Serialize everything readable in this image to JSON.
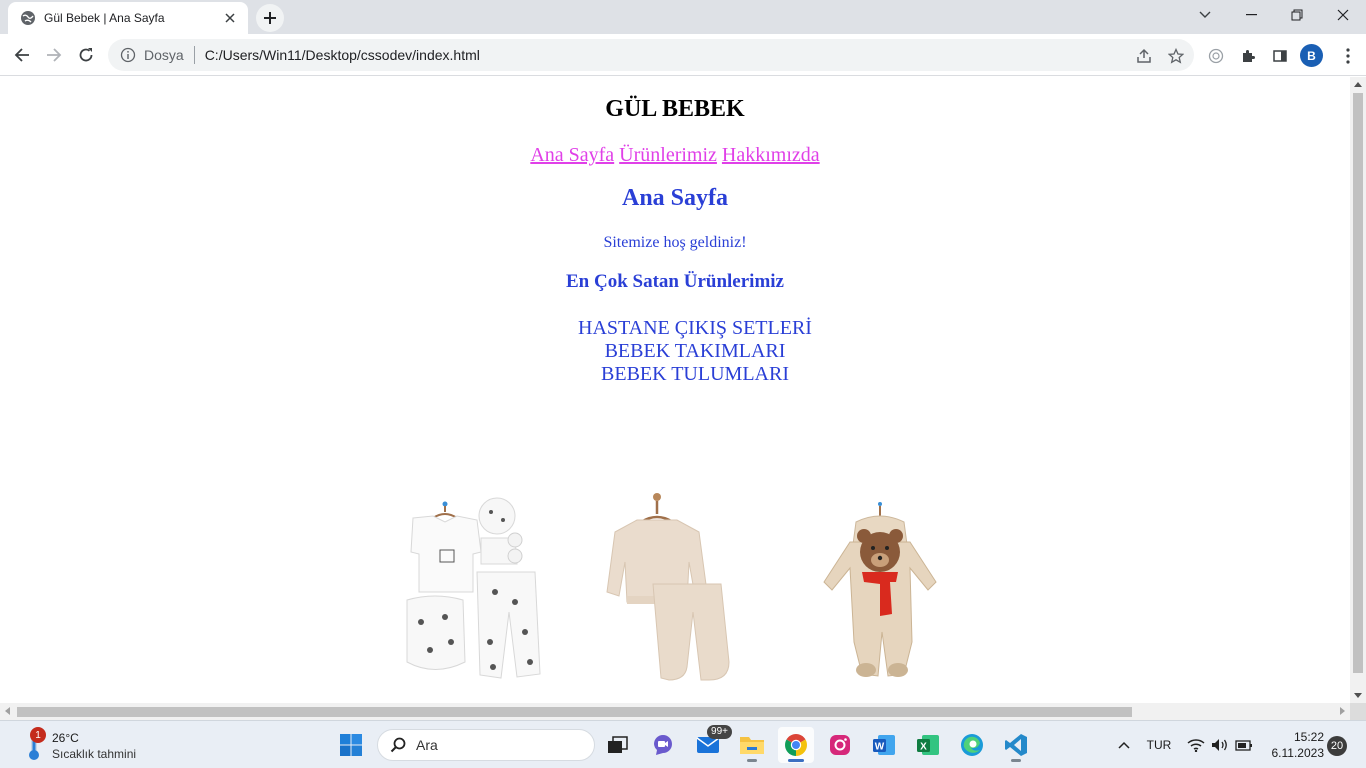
{
  "browser": {
    "tab_title": "Gül Bebek | Ana Sayfa",
    "address_scheme": "Dosya",
    "address_url": "C:/Users/Win11/Desktop/cssodev/index.html",
    "profile_initial": "B"
  },
  "site": {
    "title": "GÜL BEBEK",
    "nav": [
      "Ana Sayfa",
      "Ürünlerimiz",
      "Hakkımızda"
    ],
    "page_heading": "Ana Sayfa",
    "welcome": "Sitemize hoş geldiniz!",
    "bestseller_heading": "En Çok Satan Ürünlerimiz",
    "categories": [
      "HASTANE ÇIKIŞ SETLERİ",
      "BEBEK TAKIMLARI",
      "BEBEK TULUMLARI"
    ],
    "products": [
      {
        "name": "hospital-set-image",
        "icon": "printed white baby set"
      },
      {
        "name": "baby-outfit-image",
        "icon": "beige sweatshirt and pants"
      },
      {
        "name": "baby-jumpsuit-image",
        "icon": "beige bear jumpsuit with red scarf"
      }
    ],
    "colors": {
      "heading": "#2a3fd6",
      "nav_link": "#e040e8"
    }
  },
  "taskbar": {
    "weather_badge": "1",
    "weather_temp": "26°C",
    "weather_desc": "Sıcaklık tahmini",
    "search_label": "Ara",
    "mail_badge": "99+",
    "language": "TUR",
    "time": "15:22",
    "date": "6.11.2023",
    "notification_count": "20"
  }
}
